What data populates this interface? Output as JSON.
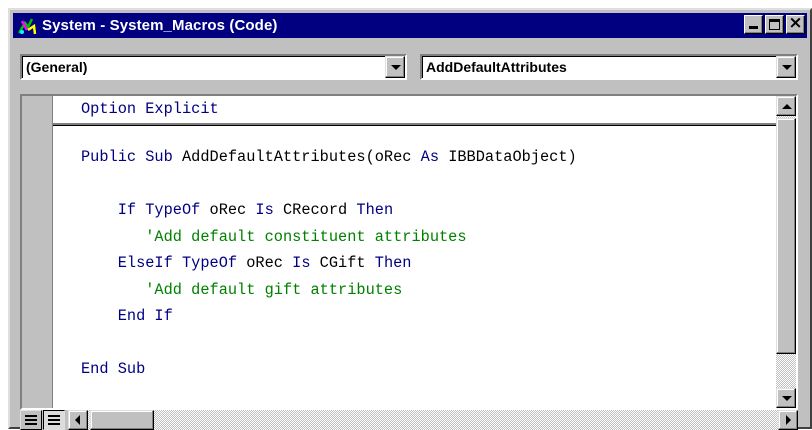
{
  "window": {
    "title": "System - System_Macros (Code)",
    "buttons": [
      "minimize",
      "maximize",
      "close"
    ]
  },
  "object_combo": {
    "selected": "(General)"
  },
  "procedure_combo": {
    "selected": "AddDefaultAttributes"
  },
  "code": {
    "declarations": [
      {
        "segments": [
          {
            "text": "Option Explicit",
            "kind": "keyword"
          }
        ]
      }
    ],
    "lines": [
      {
        "segments": [
          {
            "text": "Public Sub",
            "kind": "keyword"
          },
          {
            "text": " AddDefaultAttributes(oRec ",
            "kind": "plain"
          },
          {
            "text": "As",
            "kind": "keyword"
          },
          {
            "text": " IBBDataObject)",
            "kind": "plain"
          }
        ]
      },
      {
        "segments": []
      },
      {
        "segments": [
          {
            "text": "    If TypeOf",
            "kind": "keyword"
          },
          {
            "text": " oRec ",
            "kind": "plain"
          },
          {
            "text": "Is",
            "kind": "keyword"
          },
          {
            "text": " CRecord ",
            "kind": "plain"
          },
          {
            "text": "Then",
            "kind": "keyword"
          }
        ]
      },
      {
        "segments": [
          {
            "text": "       'Add default constituent attributes",
            "kind": "comment"
          }
        ]
      },
      {
        "segments": [
          {
            "text": "    ElseIf TypeOf",
            "kind": "keyword"
          },
          {
            "text": " oRec ",
            "kind": "plain"
          },
          {
            "text": "Is",
            "kind": "keyword"
          },
          {
            "text": " CGift ",
            "kind": "plain"
          },
          {
            "text": "Then",
            "kind": "keyword"
          }
        ]
      },
      {
        "segments": [
          {
            "text": "       'Add default gift attributes",
            "kind": "comment"
          }
        ]
      },
      {
        "segments": [
          {
            "text": "    End If",
            "kind": "keyword"
          }
        ]
      },
      {
        "segments": []
      },
      {
        "segments": [
          {
            "text": "End Sub",
            "kind": "keyword"
          }
        ]
      }
    ]
  },
  "colors": {
    "title_bar": "#000080",
    "keyword": "#000080",
    "comment": "#008000",
    "plain": "#000000",
    "chrome": "#c0c0c0"
  },
  "icons": {
    "app": "vb-code-icon",
    "view_procedure": "procedure-view-icon",
    "view_full_module": "full-module-view-icon"
  }
}
